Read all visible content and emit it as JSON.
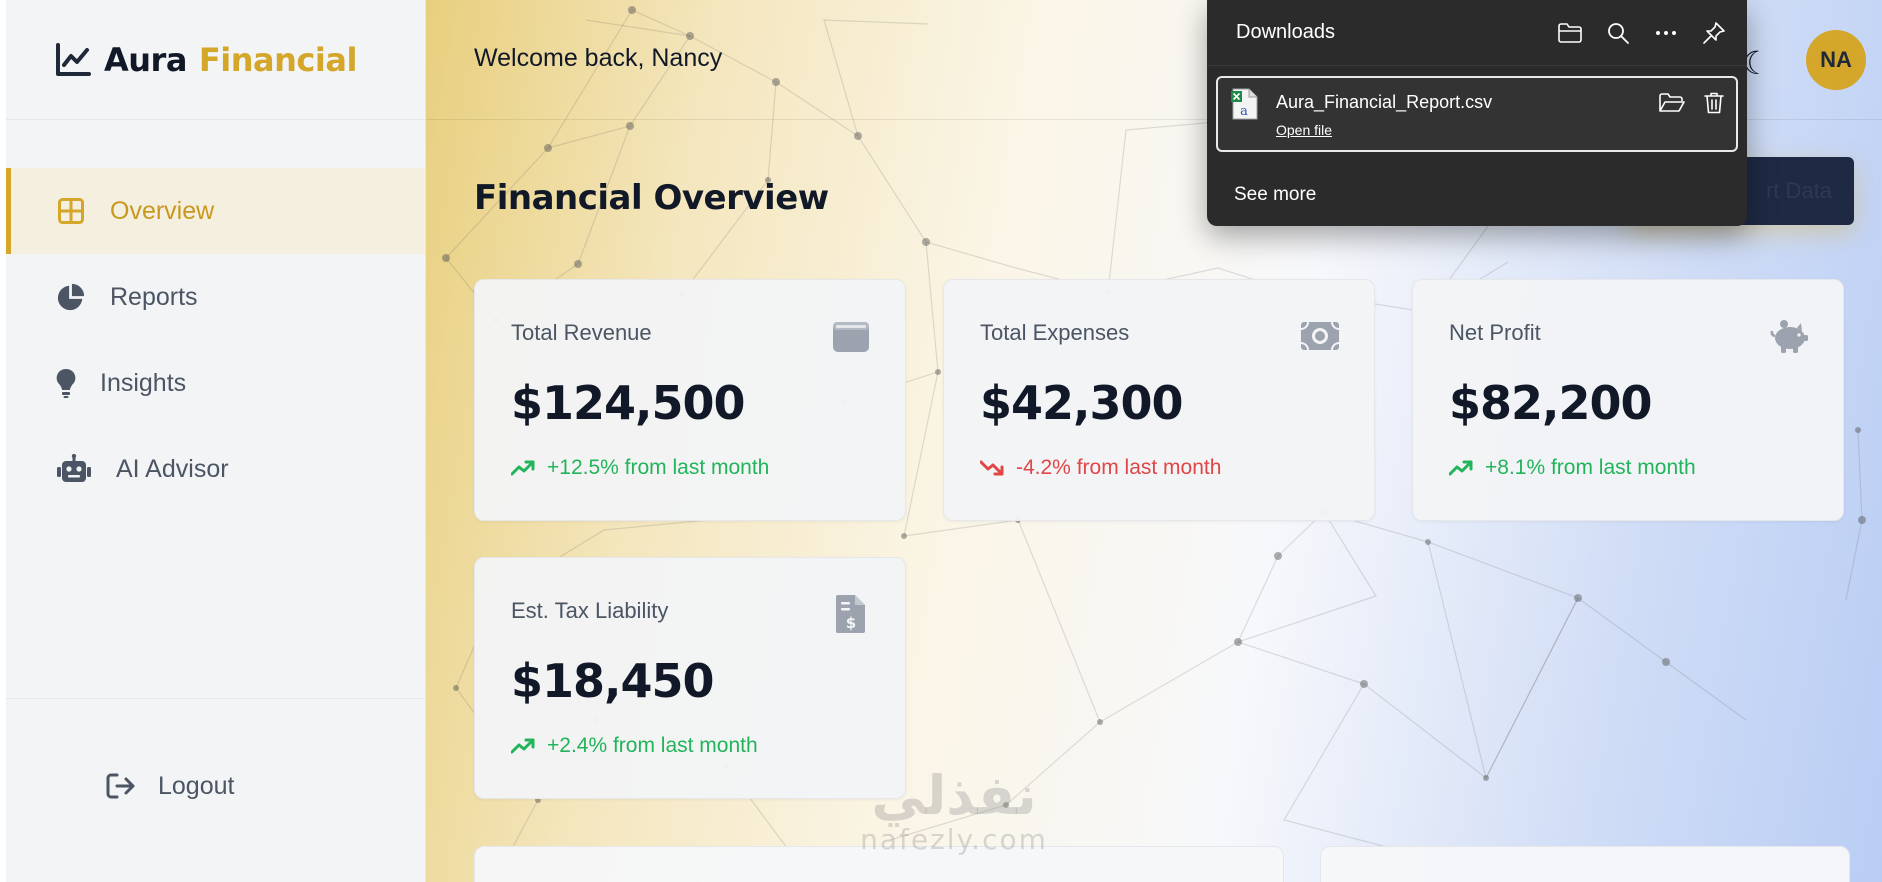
{
  "brand": {
    "name_part1": "Aura",
    "name_part2": "Financial",
    "icon": "chart-line-icon",
    "accent_color": "#d4a62a"
  },
  "sidebar": {
    "items": [
      {
        "label": "Overview",
        "icon": "grid-icon",
        "active": true
      },
      {
        "label": "Reports",
        "icon": "pie-chart-icon",
        "active": false
      },
      {
        "label": "Insights",
        "icon": "lightbulb-icon",
        "active": false
      },
      {
        "label": "AI Advisor",
        "icon": "robot-icon",
        "active": false
      }
    ],
    "logout_label": "Logout"
  },
  "header": {
    "welcome": "Welcome back, Nancy",
    "avatar_initials": "NA",
    "theme_toggle_icon": "moon-icon"
  },
  "main": {
    "title": "Financial Overview",
    "export_button_label": "rt Data",
    "cards": [
      {
        "label": "Total Revenue",
        "value": "$124,500",
        "delta": "+12.5% from last month",
        "trend": "up",
        "icon": "wallet-icon"
      },
      {
        "label": "Total Expenses",
        "value": "$42,300",
        "delta": "-4.2% from last month",
        "trend": "down",
        "icon": "money-bill-icon"
      },
      {
        "label": "Net Profit",
        "value": "$82,200",
        "delta": "+8.1% from last month",
        "trend": "up",
        "icon": "piggy-bank-icon"
      },
      {
        "label": "Est. Tax Liability",
        "value": "$18,450",
        "delta": "+2.4% from last month",
        "trend": "up",
        "icon": "invoice-dollar-icon"
      }
    ]
  },
  "downloads": {
    "title": "Downloads",
    "toolbar_icons": [
      "folder-icon",
      "search-icon",
      "more-icon",
      "pin-icon"
    ],
    "item": {
      "file_name": "Aura_Financial_Report.csv",
      "open_label": "Open file",
      "actions": [
        "open-folder-icon",
        "delete-icon"
      ]
    },
    "see_more": "See more"
  },
  "watermark": {
    "arabic": "نفذلي",
    "latin": "nafezly.com"
  },
  "colors": {
    "up": "#22b45a",
    "down": "#e04646",
    "sidebar_bg": "#f3f4f6",
    "panel_bg": "#2b2b2b"
  }
}
